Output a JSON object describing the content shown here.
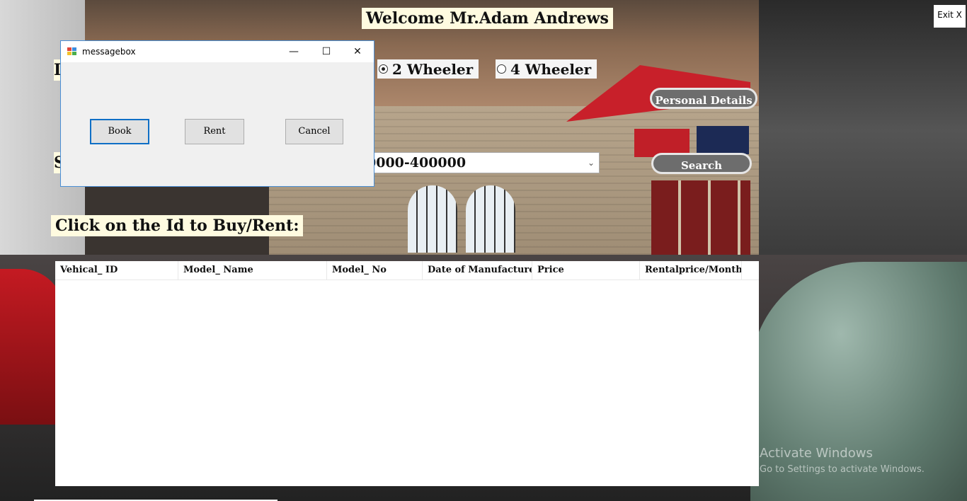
{
  "window": {
    "exit_label": "Exit X"
  },
  "header": {
    "welcome": "Welcome Mr.Adam Andrews"
  },
  "vehicle_type": {
    "options": [
      {
        "label": "2 Wheeler",
        "selected": true
      },
      {
        "label": "4 Wheeler",
        "selected": false
      }
    ]
  },
  "actions": {
    "personal_details": "Personal Details",
    "search": "Search"
  },
  "price_range": {
    "selected": "0000-400000"
  },
  "instruction": "Click on the Id to Buy/Rent:",
  "table": {
    "columns": [
      "Vehical_ ID",
      "Model_ Name",
      "Model_ No",
      "Date of Manufacture",
      "Price",
      "Rentalprice/Month"
    ],
    "rows": []
  },
  "watermark": {
    "line1": "Activate Windows",
    "line2": "Go to Settings to activate Windows."
  },
  "dialog": {
    "title": "messagebox",
    "buttons": {
      "book": "Book",
      "rent": "Rent",
      "cancel": "Cancel"
    },
    "controls": {
      "minimize": "—",
      "maximize": "☐",
      "close": "✕"
    }
  },
  "colors": {
    "label_bg": "#fffbe0",
    "pill_button": "#6d6d6d",
    "dialog_border": "#4a8fd6",
    "default_button_border": "#0f6fc6"
  }
}
